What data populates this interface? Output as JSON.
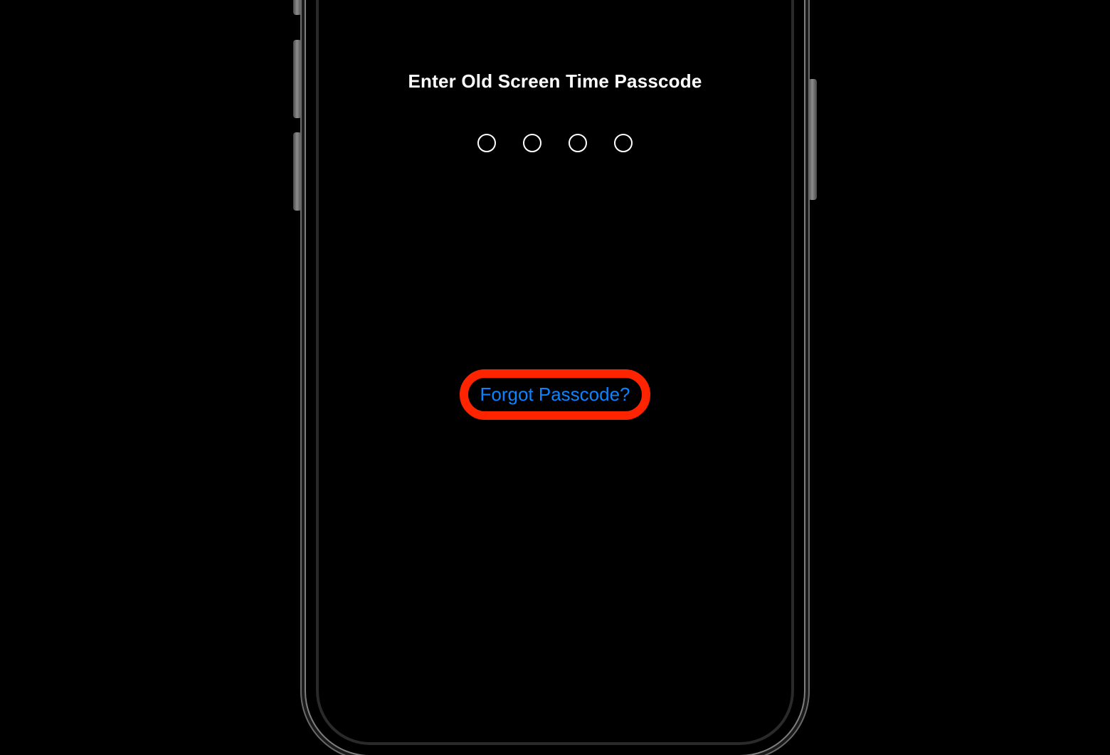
{
  "title": "Enter Old Screen Time Passcode",
  "passcode_length": 4,
  "forgot_label": "Forgot Passcode?",
  "accent_color": "#0a84ff",
  "highlight_color": "#ff2400"
}
